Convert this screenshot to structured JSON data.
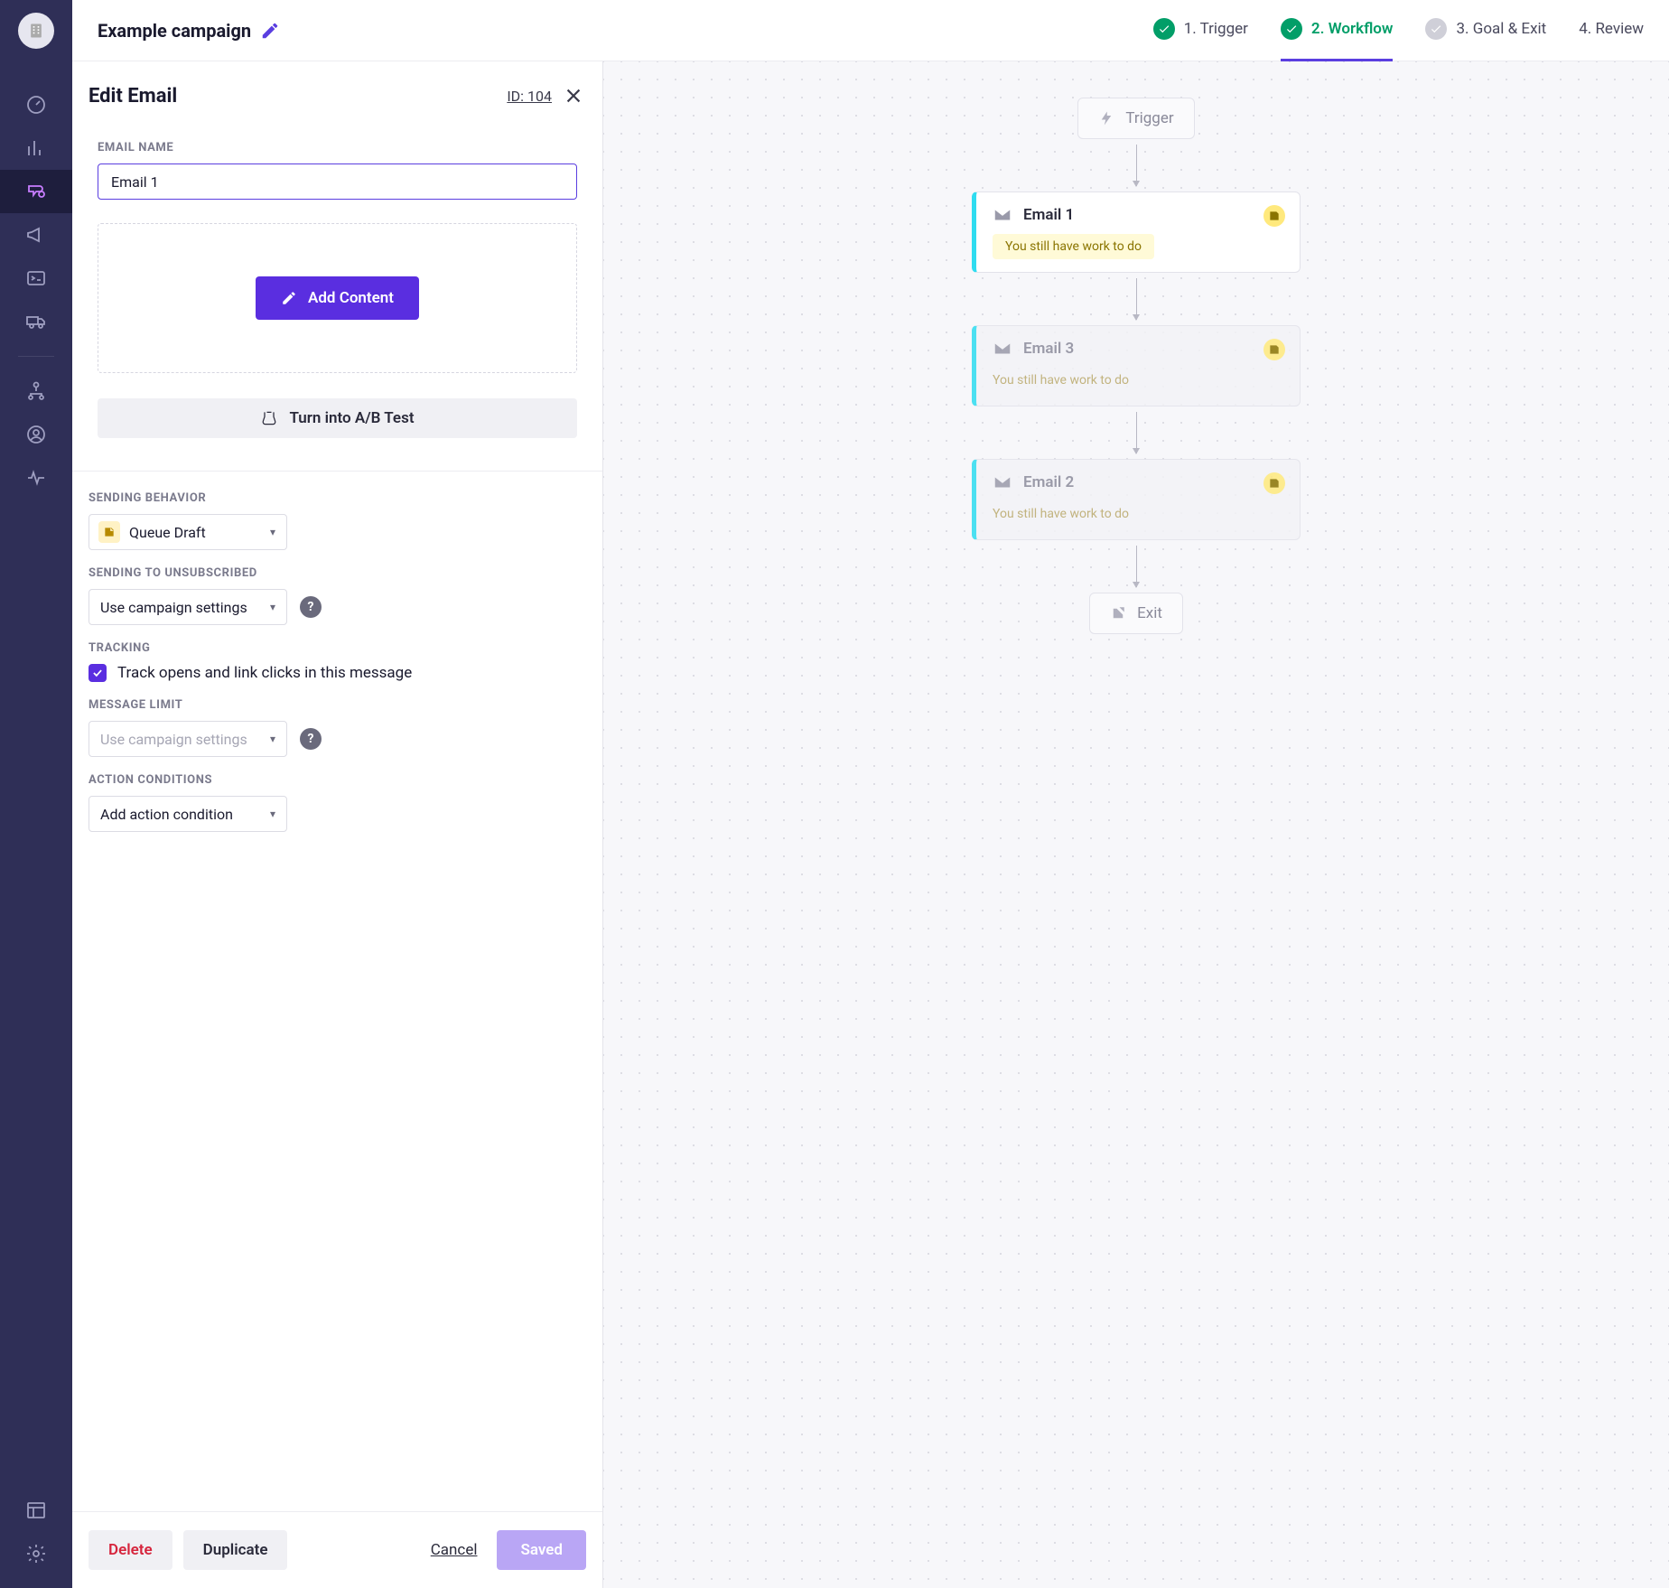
{
  "campaign": {
    "name": "Example campaign"
  },
  "header": {
    "steps": [
      {
        "label": "1. Trigger",
        "status": "done"
      },
      {
        "label": "2. Workflow",
        "status": "active"
      },
      {
        "label": "3. Goal & Exit",
        "status": "pending"
      },
      {
        "label": "4. Review",
        "status": "plain"
      }
    ]
  },
  "panel": {
    "title": "Edit Email",
    "id_label": "ID: 104",
    "labels": {
      "email_name": "EMAIL NAME",
      "sending_behavior": "SENDING BEHAVIOR",
      "unsubscribed": "SENDING TO UNSUBSCRIBED",
      "tracking": "TRACKING",
      "message_limit": "MESSAGE LIMIT",
      "action_conditions": "ACTION CONDITIONS"
    },
    "email_name_value": "Email 1",
    "add_content_label": "Add Content",
    "ab_label": "Turn into A/B Test",
    "sending_behavior_value": "Queue Draft",
    "unsubscribed_value": "Use campaign settings",
    "tracking_checkbox_label": "Track opens and link clicks in this message",
    "tracking_checked": true,
    "message_limit_value": "Use campaign settings",
    "action_condition_value": "Add action condition",
    "footer": {
      "delete": "Delete",
      "duplicate": "Duplicate",
      "cancel": "Cancel",
      "saved": "Saved"
    }
  },
  "canvas": {
    "trigger_label": "Trigger",
    "exit_label": "Exit",
    "work_text": "You still have work to do",
    "emails": [
      {
        "title": "Email 1",
        "selected": true
      },
      {
        "title": "Email 3",
        "selected": false
      },
      {
        "title": "Email 2",
        "selected": false
      }
    ]
  }
}
